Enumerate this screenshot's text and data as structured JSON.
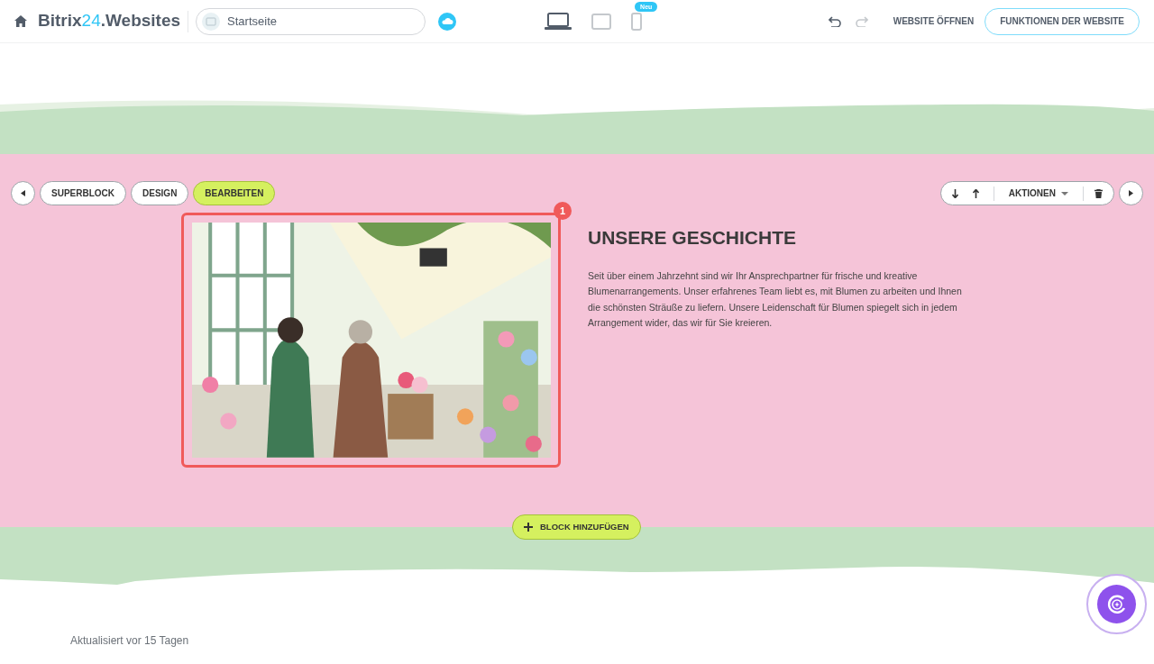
{
  "header": {
    "logo": {
      "prefix": "Bitrix",
      "accent": "24",
      "suffix": ".Websites"
    },
    "page_field": {
      "value": "Startseite"
    },
    "devices": [
      {
        "kind": "desktop",
        "selected": true
      },
      {
        "kind": "tablet",
        "selected": false
      },
      {
        "kind": "phone",
        "selected": false,
        "badge": "Neu"
      }
    ],
    "undo": {
      "disabled": false
    },
    "redo": {
      "disabled": true
    },
    "open_link": "WEBSITE ÖFFNEN",
    "features_button": "FUNKTIONEN DER WEBSITE"
  },
  "block_toolbar": {
    "left": [
      {
        "label": "SUPERBLOCK",
        "selected": false
      },
      {
        "label": "DESIGN",
        "selected": false
      },
      {
        "label": "BEARBEITEN",
        "selected": true
      }
    ],
    "actions": "AKTIONEN"
  },
  "block": {
    "image": {
      "badge": "1"
    },
    "title": "UNSERE GESCHICHTE",
    "text": "Seit über einem Jahrzehnt sind wir Ihr Ansprechpartner für frische und kreative Blumenarrangements. Unser erfahrenes Team liebt es, mit Blumen zu arbeiten und Ihnen die schönsten Sträuße zu liefern. Unsere Leidenschaft für Blumen spiegelt sich in jedem Arrangement wider, das wir für Sie kreieren."
  },
  "add_block": "BLOCK HINZUFÜGEN",
  "footer": "Aktualisiert vor 15 Tagen"
}
